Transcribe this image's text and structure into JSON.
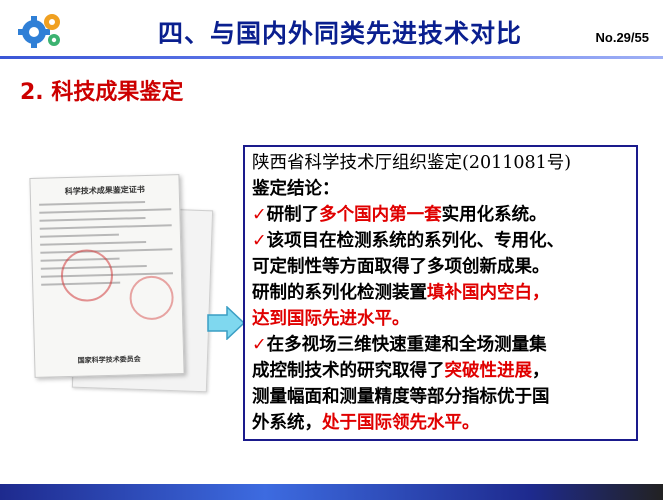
{
  "header": {
    "title": "四、与国内外同类先进技术对比",
    "page_number": "No.29/55",
    "logo_icon": "gear-logo-icon"
  },
  "section": {
    "title": "2.  科技成果鉴定"
  },
  "certificate": {
    "title": "科学技术成果鉴定证书",
    "footer": "国家科学技术委员会"
  },
  "content": {
    "line1": "陕西省科学技术厅组织鉴定(2011081号)",
    "line2": "鉴定结论：",
    "line3_a": "研制了",
    "line3_b": "多个国内第一套",
    "line3_c": "实用化系统。",
    "line4": "该项目在检测系统的系列化、专用化、",
    "line5": "可定制性等方面取得了多项创新成果。",
    "line6_a": "研制的系列化检测装置",
    "line6_b": "填补国内空白，",
    "line7": "达到国际先进水平。",
    "line8": "在多视场三维快速重建和全场测量集",
    "line9_a": "成控制技术的研究取得了",
    "line9_b": "突破性进展",
    "line9_c": "，",
    "line10": "测量幅面和测量精度等部分指标优于国",
    "line11_a": "外系统，",
    "line11_b": "处于国际领先水平。",
    "check_mark": "✓"
  },
  "colors": {
    "title_blue": "#0a1f8f",
    "accent_red": "#e00000",
    "box_border": "#1a1a8c"
  }
}
